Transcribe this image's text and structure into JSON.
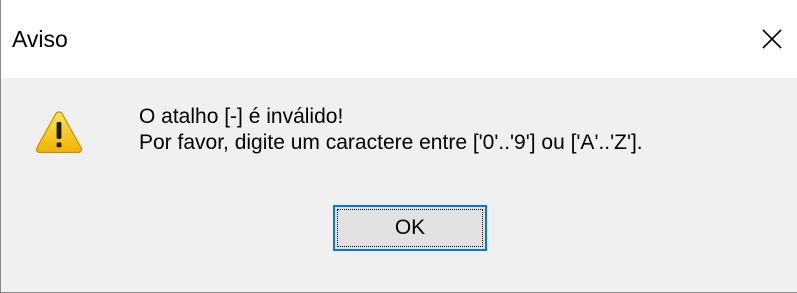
{
  "window": {
    "title": "Aviso"
  },
  "icons": {
    "close": "close-icon",
    "warning": "warning-icon"
  },
  "message": {
    "line1": "O atalho [-] é inválido!",
    "line2": "Por favor, digite um caractere entre ['0'..'9'] ou ['A'..'Z']."
  },
  "buttons": {
    "ok_label": "OK"
  },
  "colors": {
    "content_background": "#f0f0f0",
    "titlebar_background": "#ffffff",
    "button_background": "#e1e1e1",
    "button_focus_border": "#0078d7",
    "warning_fill": "#f5c400"
  }
}
